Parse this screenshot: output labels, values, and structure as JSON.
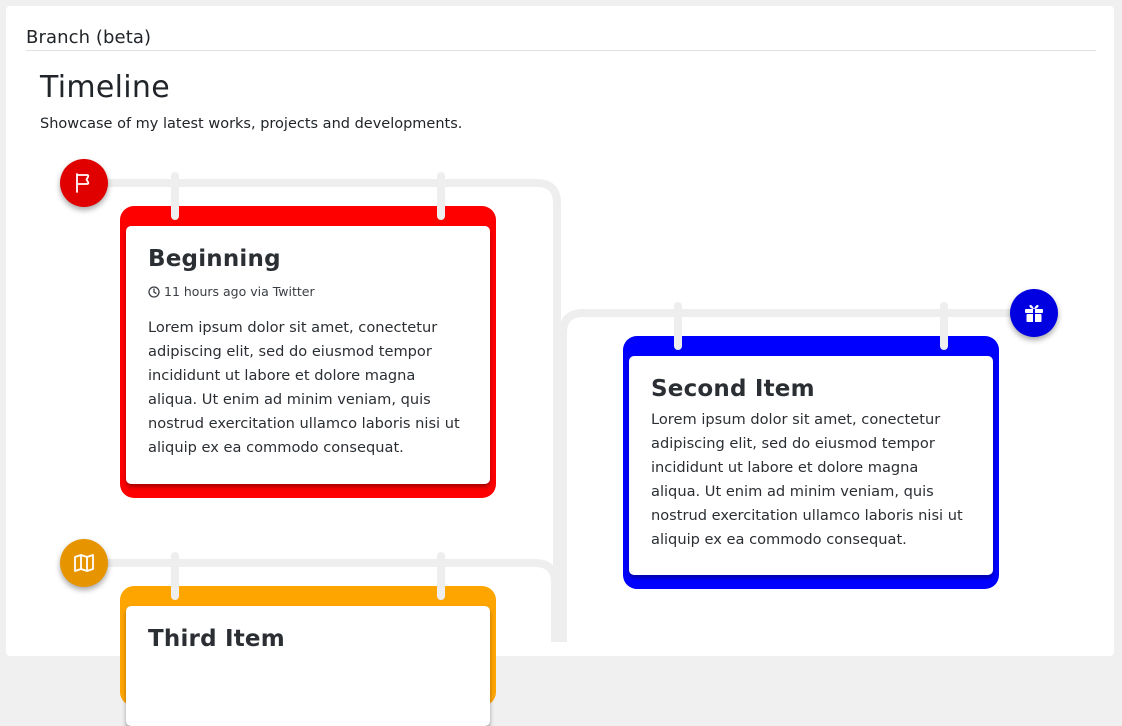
{
  "panel": {
    "title": "Branch (beta)"
  },
  "timeline": {
    "heading": "Timeline",
    "subtitle": "Showcase of my latest works, projects and developments."
  },
  "items": [
    {
      "title": "Beginning",
      "meta": "11 hours ago via Twitter",
      "body": "Lorem ipsum dolor sit amet, conectetur adipiscing elit, sed do eiusmod tempor incididunt ut labore et dolore magna aliqua. Ut enim ad minim veniam, quis nostrud exercitation ullamco laboris nisi ut aliquip ex ea commodo consequat.",
      "color": "#ff0000",
      "marker_color": "#e00000",
      "icon": "flag-icon"
    },
    {
      "title": "Second Item",
      "body": "Lorem ipsum dolor sit amet, conectetur adipiscing elit, sed do eiusmod tempor incididunt ut labore et dolore magna aliqua. Ut enim ad minim veniam, quis nostrud exercitation ullamco laboris nisi ut aliquip ex ea commodo consequat.",
      "color": "#0000ff",
      "marker_color": "#0000e0",
      "icon": "gift-icon"
    },
    {
      "title": "Third Item",
      "color": "#ffa500",
      "marker_color": "#e69500",
      "icon": "map-icon"
    }
  ]
}
